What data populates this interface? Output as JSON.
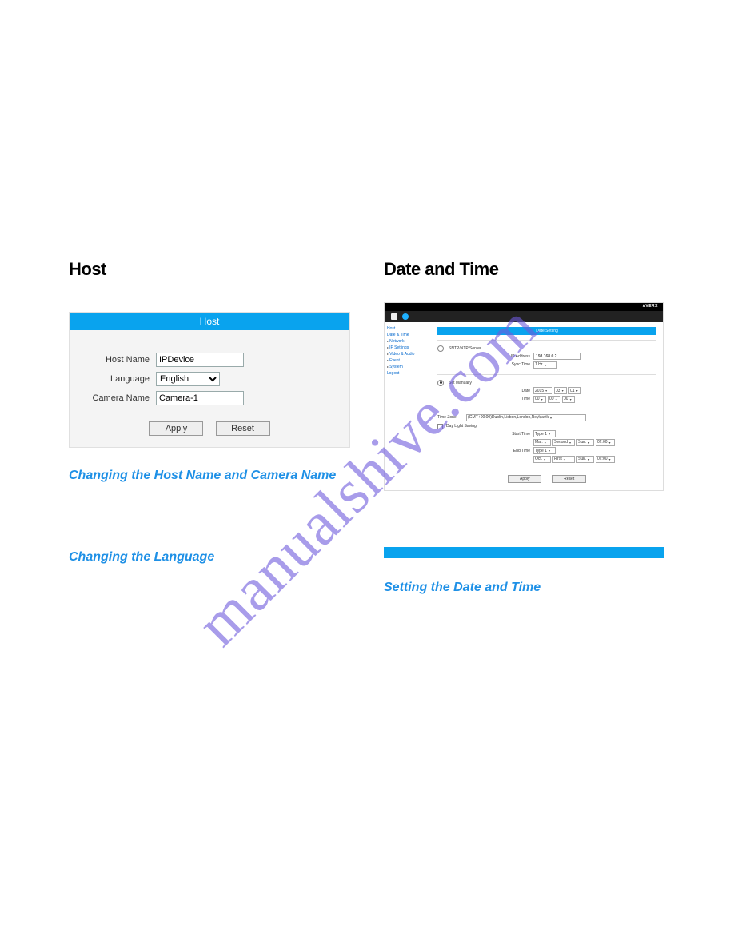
{
  "watermark": "manualshive.com",
  "left": {
    "heading": "Host",
    "sub1": "Changing the Host Name and Camera Name",
    "sub2": "Changing the Language"
  },
  "right": {
    "heading": "Date and Time",
    "sub1": "Setting the Date and Time"
  },
  "host_panel": {
    "title": "Host",
    "host_name_label": "Host Name",
    "host_name_value": "IPDevice",
    "language_label": "Language",
    "language_value": "English",
    "camera_name_label": "Camera Name",
    "camera_name_value": "Camera-1",
    "apply": "Apply",
    "reset": "Reset"
  },
  "date_panel": {
    "brand": "AVERX",
    "nav": {
      "host": "Host",
      "date_time": "Date & Time",
      "network": "Network",
      "ip_settings": "IP Settings",
      "video_audio": "Video & Audio",
      "event": "Event",
      "system": "System",
      "logout": "Logout"
    },
    "title": "Date Setting",
    "sntp_label": "SNTP/NTP Server",
    "ip_addr_label": "IP Address",
    "ip_addr_value": "198.168.0.2",
    "sync_label": "Sync Time",
    "sync_value": "1 Hr.",
    "manual_label": "Set Manually",
    "date_label": "Date",
    "date_y": "2015",
    "date_m": "03",
    "date_d": "01",
    "time_label": "Time",
    "time_h": "00",
    "time_m": "00",
    "time_s": "00",
    "tz_label": "Time Zone",
    "tz_value": "(GMT+00:00)Dublin,Lisbon,London,Reykjavik",
    "dst_label": "Day Light Saving",
    "start_label": "Start Time",
    "start_type": "Type 1",
    "start_mo": "Mar.",
    "start_ord": "Second",
    "start_day": "Sun.",
    "start_hr": "02:00",
    "end_label": "End Time",
    "end_type": "Type 1",
    "end_mo": "Oct.",
    "end_ord": "First",
    "end_day": "Sun.",
    "end_hr": "02:00",
    "apply": "Apply",
    "reset": "Reset"
  }
}
